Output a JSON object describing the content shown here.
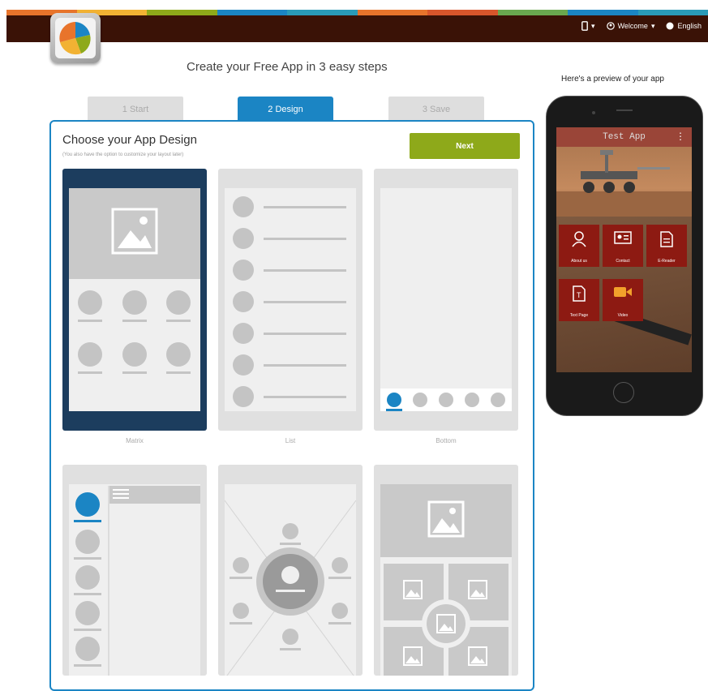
{
  "topbar": {
    "stripe_colors": [
      "#e8742b",
      "#f2b233",
      "#8ea91a",
      "#1b85c4",
      "#2a9bb8",
      "#e8742b",
      "#d9562b",
      "#6aa84f",
      "#1b85c4",
      "#2a9bb8"
    ],
    "background": "#3a1206",
    "welcome_label": "Welcome",
    "language_label": "English"
  },
  "header": {
    "headline": "Create your Free App in 3 easy steps"
  },
  "steps": {
    "items": [
      "1 Start",
      "2 Design",
      "3 Save"
    ],
    "active_index": 1
  },
  "design_panel": {
    "title": "Choose your App Design",
    "subtitle": "(You also have the option to customize your layout later)",
    "next_label": "Next",
    "accent_color": "#1b85c4",
    "next_color": "#8ea91a",
    "layouts": [
      "Matrix",
      "List",
      "Bottom"
    ]
  },
  "preview": {
    "label": "Here's a preview of your app",
    "app_title": "Test App",
    "tiles": [
      "About us",
      "Contact",
      "E-Reader",
      "Text Page",
      "Video"
    ],
    "tile_icons": [
      "person-icon",
      "id-card-icon",
      "document-icon",
      "text-page-icon",
      "video-camera-icon"
    ]
  }
}
